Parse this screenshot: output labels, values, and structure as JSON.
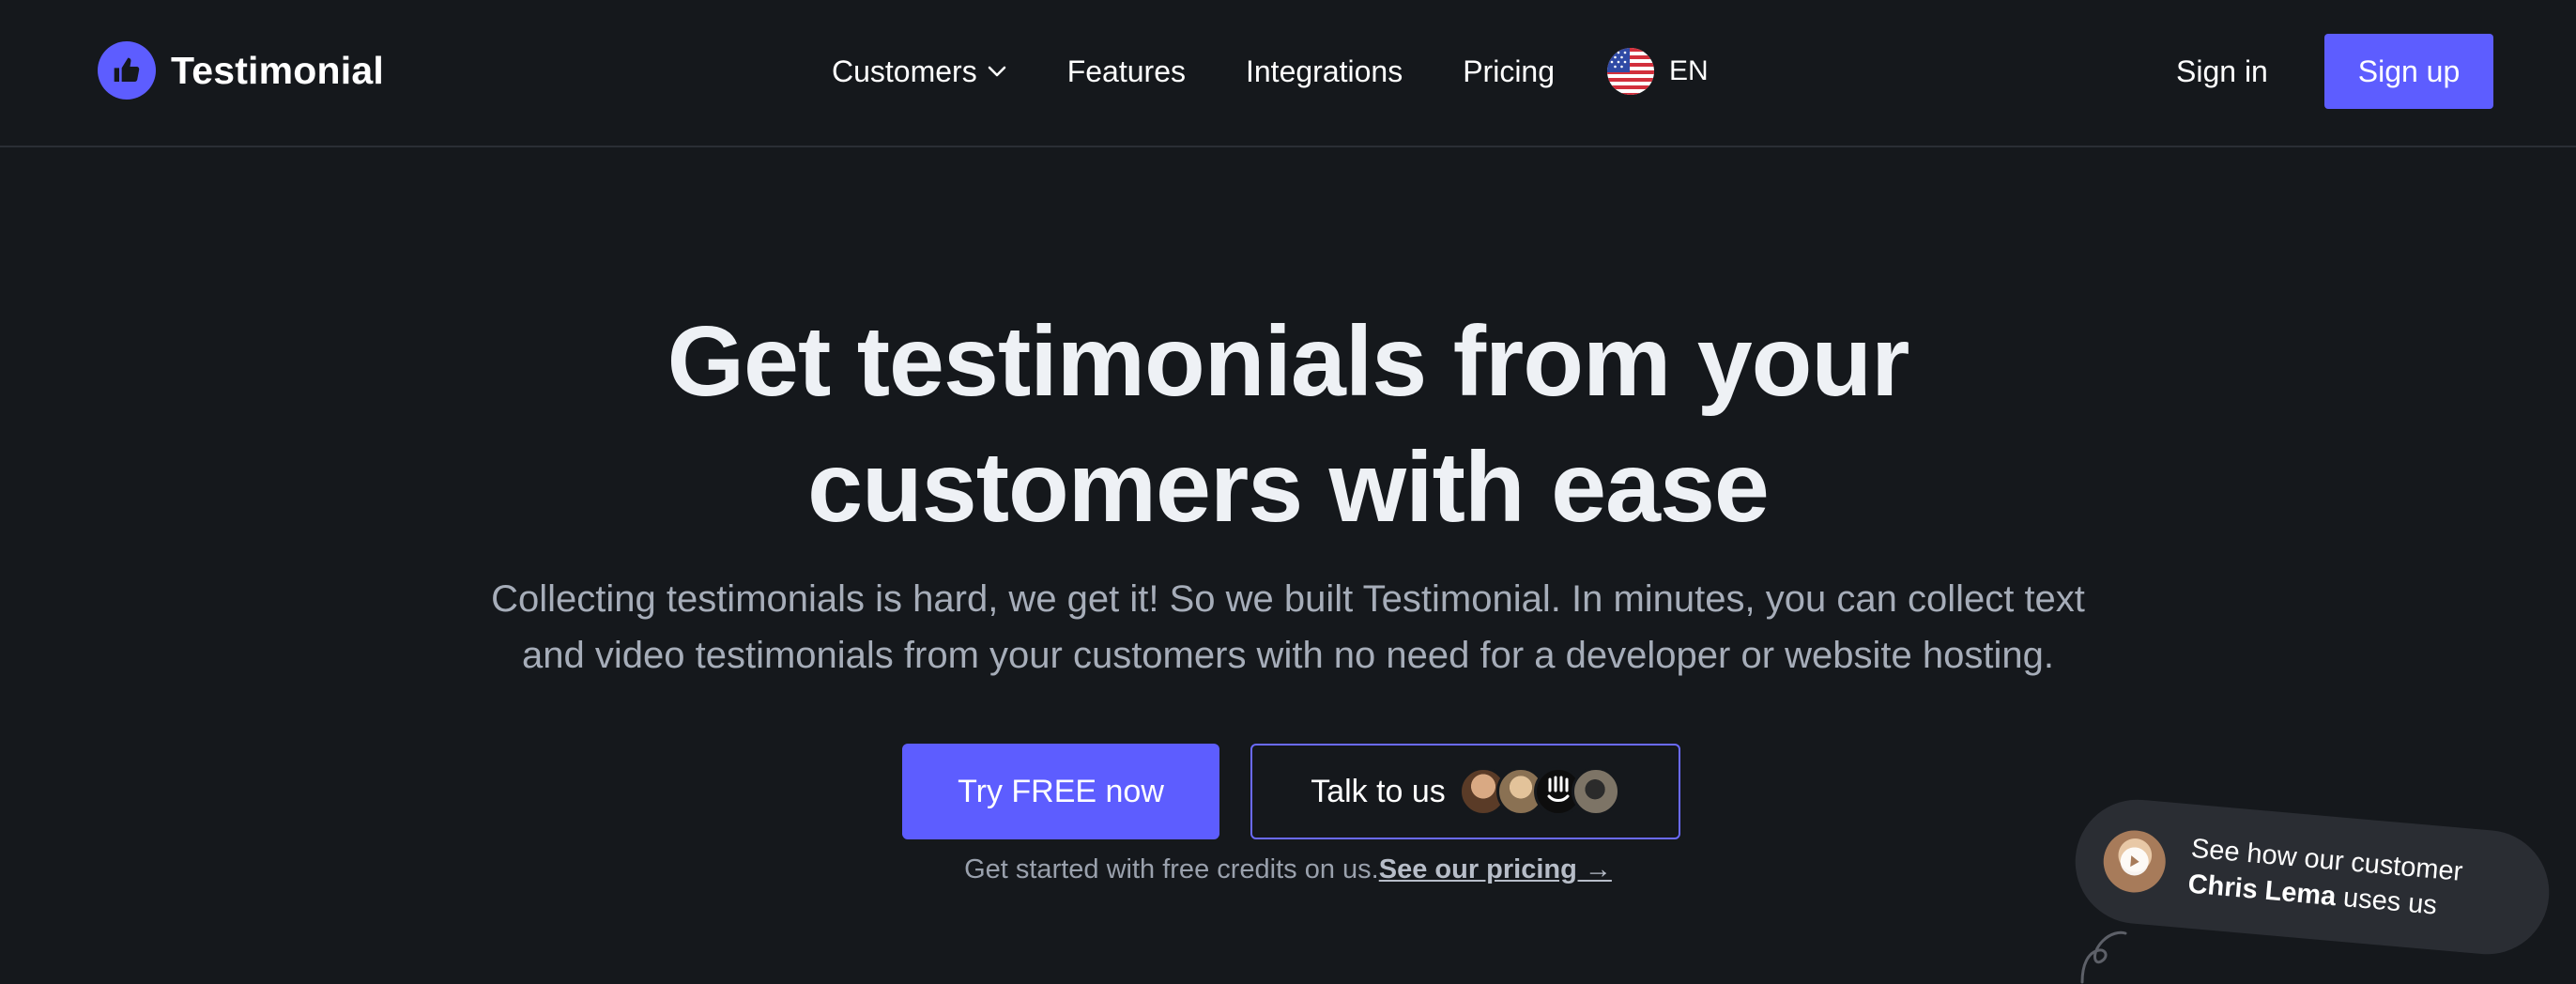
{
  "brand": {
    "name": "Testimonial",
    "logo_icon": "thumbs-up-icon",
    "accent": "#5d5dff"
  },
  "nav": {
    "links": [
      {
        "label": "Customers",
        "has_dropdown": true
      },
      {
        "label": "Features"
      },
      {
        "label": "Integrations"
      },
      {
        "label": "Pricing"
      }
    ],
    "language": {
      "flag": "us-flag-icon",
      "label": "EN"
    },
    "signin_label": "Sign in",
    "signup_label": "Sign up"
  },
  "hero": {
    "title_line1": "Get testimonials from your",
    "title_line2": "customers with ease",
    "subtitle_line1": "Collecting testimonials is hard, we get it! So we built Testimonial. In minutes, you can collect text",
    "subtitle_line2": "and video testimonials from your customers with no need for a developer or website hosting.",
    "try_label": "Try FREE now",
    "talk_label": "Talk to us",
    "credits_text": "Get started with free credits on us.",
    "pricing_link": "See our pricing →"
  },
  "video_card": {
    "line1": "See how our customer",
    "name": "Chris Lema",
    "line2_suffix": " uses us"
  },
  "colors": {
    "background": "#15181c",
    "primary": "#5d5dff",
    "text": "#eef1f5",
    "muted": "#a6adb9"
  }
}
